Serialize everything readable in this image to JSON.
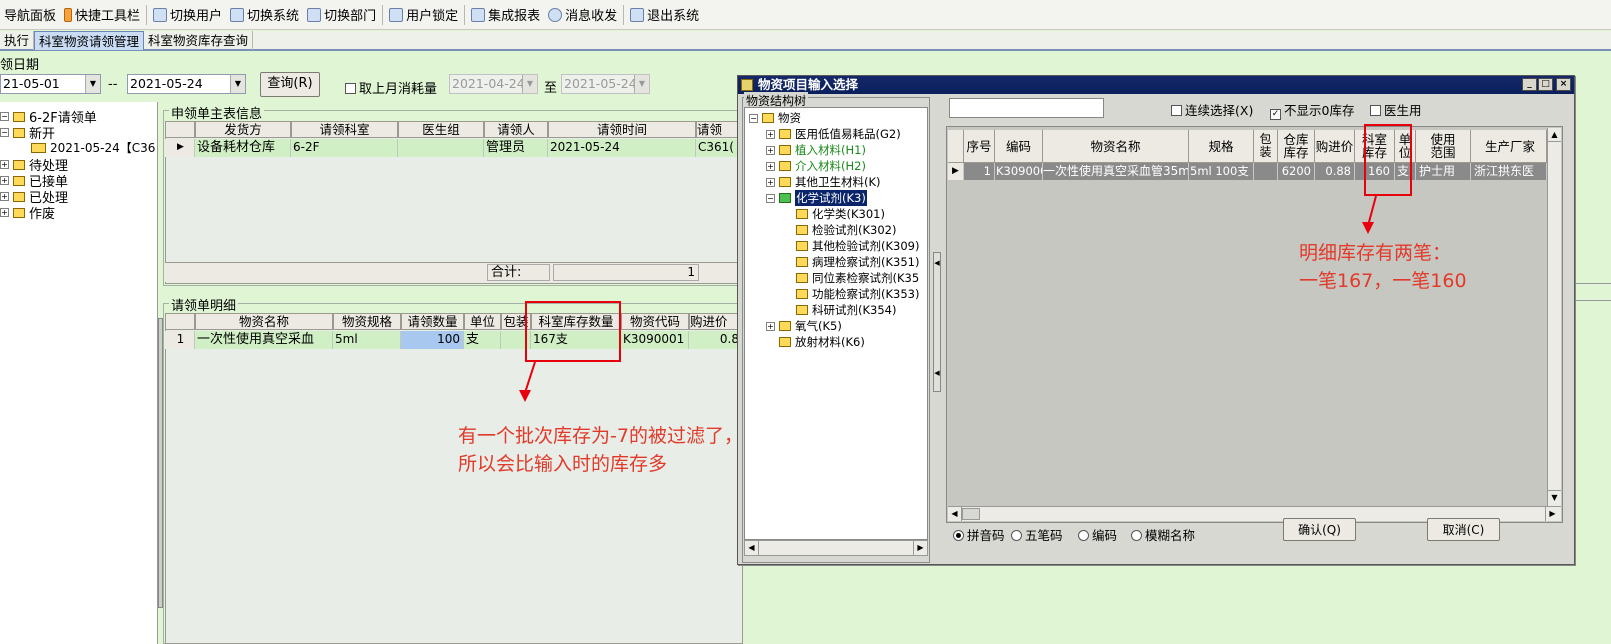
{
  "toolbar": {
    "items": [
      {
        "label": "导航面板"
      },
      {
        "label": "快捷工具栏"
      },
      {
        "label": "切换用户"
      },
      {
        "label": "切换系统"
      },
      {
        "label": "切换部门"
      },
      {
        "label": "用户锁定"
      },
      {
        "label": "集成报表"
      },
      {
        "label": "消息收发"
      },
      {
        "label": "退出系统"
      }
    ]
  },
  "tabs": [
    {
      "label": "执行"
    },
    {
      "label": "科室物资请领管理"
    },
    {
      "label": "科室物资库存查询"
    }
  ],
  "filter": {
    "date_label": "领日期",
    "date_from": "21-05-01",
    "date_sep": "--",
    "date_to": "2021-05-24",
    "query_button": "查询(R)",
    "last_month_check": "取上月消耗量",
    "last_from": "2021-04-24",
    "to_label": "至",
    "last_to": "2021-05-24"
  },
  "left_tree": {
    "root": "6-2F请领单",
    "new": "新开",
    "new_child": "2021-05-24【C36",
    "items": [
      "待处理",
      "已接单",
      "已处理",
      "作废"
    ]
  },
  "master": {
    "title": "申领单主表信息",
    "columns": [
      "发货方",
      "请领科室",
      "医生组",
      "请领人",
      "请领时间",
      "请领"
    ],
    "row": [
      "设备耗材仓库",
      "6-2F",
      "",
      "管理员",
      "2021-05-24",
      "C361("
    ],
    "total_label": "合计:",
    "total_value": "1"
  },
  "detail": {
    "title": "请领单明细",
    "columns": [
      "物资名称",
      "物资规格",
      "请领数量",
      "单位",
      "包装",
      "科室库存数量",
      "物资代码",
      "购进价"
    ],
    "row": {
      "idx": "1",
      "name": "一次性使用真空采血",
      "spec": "5ml",
      "qty": "100",
      "unit": "支",
      "pack": "",
      "stock": "167支",
      "code": "K3090001",
      "price": "0.8"
    }
  },
  "annotation_left": {
    "line1": "有一个批次库存为-7的被过滤了，",
    "line2": "所以会比输入时的库存多"
  },
  "annotation_right": {
    "line1": "明细库存有两笔：",
    "line2": "一笔167，一笔160"
  },
  "dialog": {
    "title": "物资项目输入选择",
    "tree_title": "物资结构树",
    "tree": [
      {
        "label": "物资",
        "level": 0,
        "type": "minus",
        "color": "#000000"
      },
      {
        "label": "医用低值易耗品(G2)",
        "level": 1,
        "type": "plus",
        "color": "#000000"
      },
      {
        "label": "植入材料(H1)",
        "level": 1,
        "type": "plus",
        "color": "#1a8a1a"
      },
      {
        "label": "介入材料(H2)",
        "level": 1,
        "type": "plus",
        "color": "#1a8a1a"
      },
      {
        "label": "其他卫生材料(K)",
        "level": 1,
        "type": "plus",
        "color": "#000000"
      },
      {
        "label": "化学试剂(K3)",
        "level": 1,
        "type": "minus",
        "color": "#ffffff",
        "selected": true
      },
      {
        "label": "化学类(K301)",
        "level": 2,
        "type": "leaf",
        "color": "#000000"
      },
      {
        "label": "检验试剂(K302)",
        "level": 2,
        "type": "leaf",
        "color": "#000000"
      },
      {
        "label": "其他检验试剂(K309)",
        "level": 2,
        "type": "leaf",
        "color": "#000000"
      },
      {
        "label": "病理检察试剂(K351)",
        "level": 2,
        "type": "leaf",
        "color": "#000000"
      },
      {
        "label": "同位素检察试剂(K35",
        "level": 2,
        "type": "leaf",
        "color": "#000000"
      },
      {
        "label": "功能检察试剂(K353)",
        "level": 2,
        "type": "leaf",
        "color": "#000000"
      },
      {
        "label": "科研试剂(K354)",
        "level": 2,
        "type": "leaf",
        "color": "#000000"
      },
      {
        "label": "氧气(K5)",
        "level": 1,
        "type": "plus",
        "color": "#000000"
      },
      {
        "label": "放射材料(K6)",
        "level": 1,
        "type": "leaf",
        "color": "#000000"
      }
    ],
    "continuous_select": "连续选择(X)",
    "hide_zero_stock": "不显示0库存",
    "doctor_use": "医生用",
    "columns": [
      "序号",
      "编码",
      "物资名称",
      "规格",
      "包装",
      "仓库库存",
      "购进价",
      "科室库存",
      "单位",
      "使用范围",
      "生产厂家"
    ],
    "row": [
      "1",
      "K309000",
      "一次性使用真空采血管35m",
      "5ml 100支",
      "",
      "6200",
      "0.88",
      "160",
      "支",
      "护士用",
      "浙江拱东医"
    ],
    "radios": [
      "拼音码",
      "五笔码",
      "编码",
      "模糊名称"
    ],
    "ok_button": "确认(Q)",
    "cancel_button": "取消(C)"
  }
}
